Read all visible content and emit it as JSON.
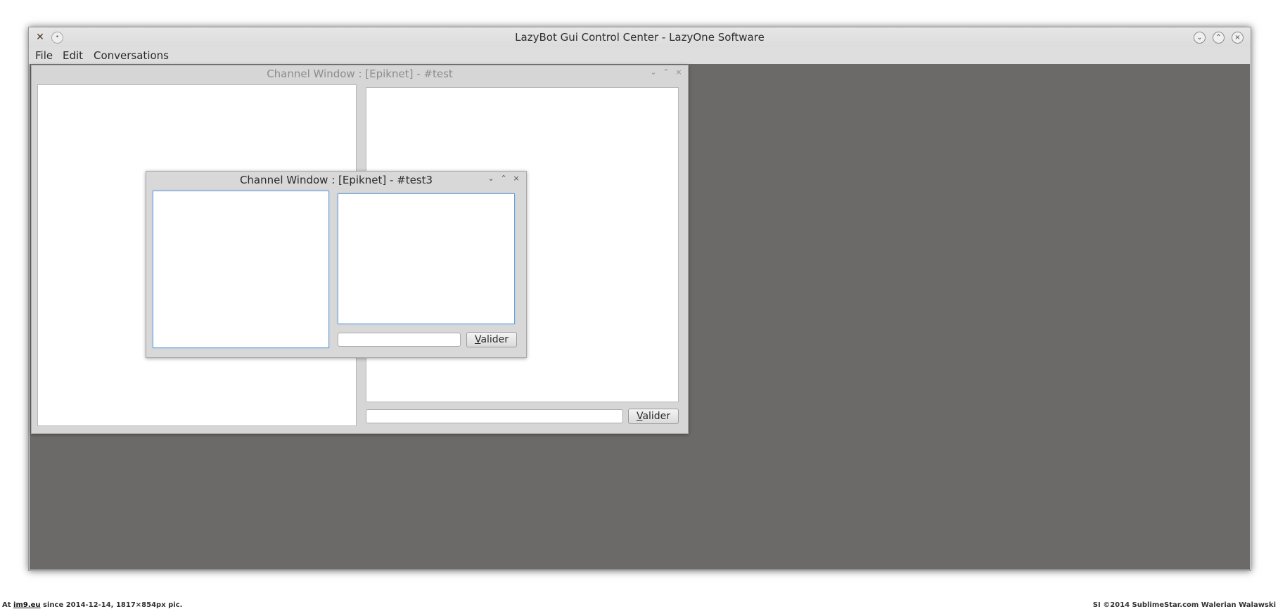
{
  "window": {
    "title": "LazyBot Gui Control Center - LazyOne Software",
    "app_icon": "tools-icon",
    "pin_icon": "pin-icon",
    "controls": [
      "minimize",
      "maximize",
      "close"
    ]
  },
  "menu": [
    {
      "label": "File"
    },
    {
      "label": "Edit"
    },
    {
      "label": "Conversations"
    }
  ],
  "subwindows": [
    {
      "title": "Channel Window : [Epiknet] - #test",
      "input_value": "",
      "button_pre": "",
      "button_mnemonic": "V",
      "button_rest": "alider"
    },
    {
      "title": "Channel Window : [Epiknet] - #test3",
      "input_value": "",
      "button_pre": "",
      "button_mnemonic": "V",
      "button_rest": "alider"
    }
  ],
  "footer": {
    "left_prefix": "At ",
    "left_link": "im9.eu",
    "left_suffix": " since 2014-12-14, 1817×854px pic.",
    "right": "SI ©2014 SublimeStar.com Walerian Walawski"
  },
  "colors": {
    "mdi_background": "#6b6a69",
    "window_chrome": "#dcdcdc",
    "focus_border": "#6fa0d8"
  }
}
